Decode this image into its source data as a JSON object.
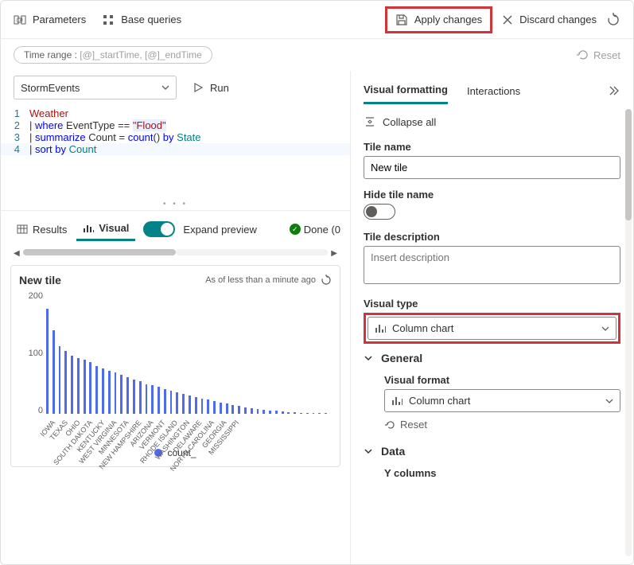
{
  "topbar": {
    "parameters": "Parameters",
    "base_queries": "Base queries",
    "apply_changes": "Apply changes",
    "discard_changes": "Discard changes"
  },
  "row2": {
    "time_label": "Time range :",
    "time_value": "[@]_startTime, [@]_endTime",
    "reset": "Reset"
  },
  "datasource": {
    "name": "StormEvents",
    "run": "Run"
  },
  "editor": {
    "l1": "Weather",
    "l2_pipe": "| ",
    "l2_where": "where",
    "l2_rest": " EventType == ",
    "l2_str": "\"Flood\"",
    "l3_pipe": "| ",
    "l3_summ": "summarize",
    "l3_rest1": " Count = ",
    "l3_fn": "count",
    "l3_rest2": "() ",
    "l3_by": "by",
    "l3_rest3": " State",
    "l4_pipe": "| ",
    "l4_sort": "sort by",
    "l4_rest": " Count"
  },
  "tabs": {
    "results": "Results",
    "visual": "Visual",
    "expand": "Expand preview",
    "done": "Done (0"
  },
  "chart": {
    "title": "New tile",
    "asof": "As of less than a minute ago",
    "legend": "count_",
    "y0": "0",
    "y100": "100",
    "y200": "200"
  },
  "chart_data": {
    "type": "bar",
    "title": "New tile",
    "ylabel": "",
    "xlabel": "",
    "ylim": [
      0,
      200
    ],
    "series": [
      {
        "name": "count_",
        "values": [
          176,
          140,
          113,
          105,
          98,
          94,
          91,
          87,
          80,
          76,
          72,
          69,
          66,
          62,
          58,
          55,
          50,
          48,
          45,
          42,
          39,
          36,
          33,
          31,
          28,
          26,
          24,
          22,
          19,
          17,
          15,
          13,
          11,
          9,
          8,
          7,
          6,
          5,
          4,
          3,
          3,
          2,
          2,
          2,
          1,
          1
        ]
      }
    ],
    "categories": [
      "IOWA",
      "TEXAS",
      "",
      "OHIO",
      "",
      "SOUTH DAKOTA",
      "",
      "KENTUCKY",
      "",
      "WEST VIRGINIA",
      "",
      "MINNESOTA",
      "",
      "NEW HAMPSHIRE",
      "",
      "ARIZONA",
      "",
      "VERMONT",
      "",
      "RHODE ISLAND",
      "",
      "WASHINGTON",
      "",
      "DELAWARE",
      "",
      "NORTH CAROLINA",
      "",
      "GEORGIA",
      "",
      "MISSISSIPPI",
      "",
      "",
      "",
      "",
      "",
      "",
      "",
      "",
      "",
      "",
      "",
      "",
      "",
      "",
      "",
      ""
    ],
    "visible_x_labels": [
      "IOWA",
      "TEXAS",
      "OHIO",
      "SOUTH DAKOTA",
      "KENTUCKY",
      "WEST VIRGINIA",
      "MINNESOTA",
      "NEW HAMPSHIRE",
      "ARIZONA",
      "VERMONT",
      "RHODE ISLAND",
      "WASHINGTON",
      "DELAWARE",
      "NORTH CAROLINA",
      "GEORGIA",
      "MISSISSIPPI"
    ]
  },
  "right": {
    "visual_formatting": "Visual formatting",
    "interactions": "Interactions",
    "collapse_all": "Collapse all",
    "tile_name_label": "Tile name",
    "tile_name_value": "New tile",
    "hide_tile_label": "Hide tile name",
    "tile_desc_label": "Tile description",
    "tile_desc_placeholder": "Insert description",
    "visual_type_label": "Visual type",
    "visual_type_value": "Column chart",
    "general": "General",
    "visual_format_label": "Visual format",
    "visual_format_value": "Column chart",
    "reset": "Reset",
    "data": "Data",
    "y_columns": "Y columns"
  }
}
